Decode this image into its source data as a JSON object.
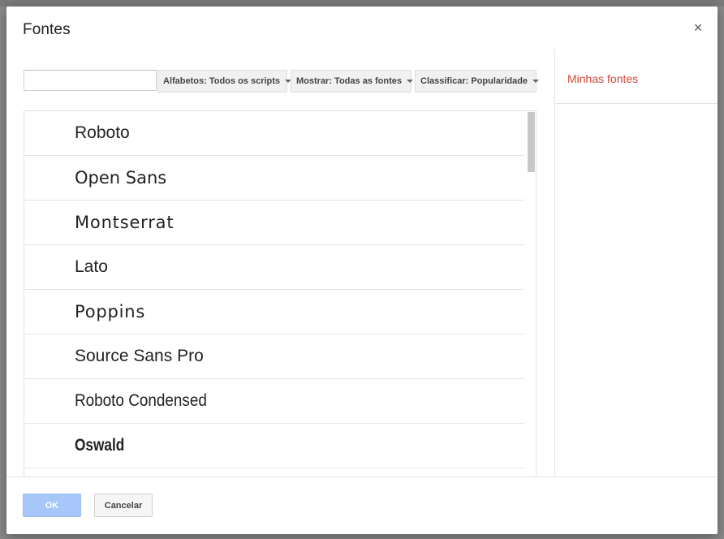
{
  "dialog": {
    "title": "Fontes",
    "close_label": "×"
  },
  "filters": {
    "search_value": "",
    "scripts_label": "Alfabetos: Todos os scripts",
    "show_label": "Mostrar: Todas as fontes",
    "sort_label": "Classificar: Popularidade"
  },
  "fonts": [
    {
      "label": "Roboto",
      "family": "Liberation Sans",
      "style": "normal"
    },
    {
      "label": "Open Sans",
      "family": "DejaVu Sans",
      "style": "normal"
    },
    {
      "label": "Montserrat",
      "family": "DejaVu Sans",
      "style": "wide"
    },
    {
      "label": "Lato",
      "family": "Liberation Sans",
      "style": "normal"
    },
    {
      "label": "Poppins",
      "family": "DejaVu Sans",
      "style": "wide"
    },
    {
      "label": "Source Sans Pro",
      "family": "Liberation Sans",
      "style": "normal"
    },
    {
      "label": "Roboto Condensed",
      "family": "Liberation Sans",
      "style": "condensed"
    },
    {
      "label": "Oswald",
      "family": "Liberation Sans",
      "style": "oswald"
    }
  ],
  "my_fonts": {
    "title": "Minhas fontes"
  },
  "footer": {
    "ok_label": "OK",
    "cancel_label": "Cancelar"
  },
  "colors": {
    "accent_red": "#d14836",
    "ok_button": "#a7c7fa"
  }
}
